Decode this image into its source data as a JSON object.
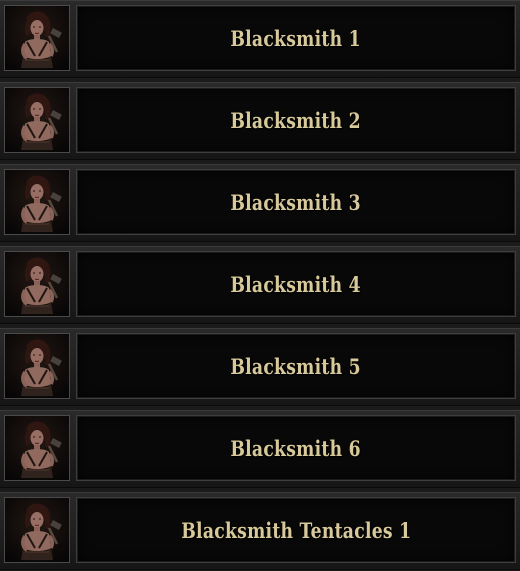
{
  "skins": [
    {
      "label": "Blacksmith 1",
      "icon": "blacksmith-portrait-icon"
    },
    {
      "label": "Blacksmith 2",
      "icon": "blacksmith-portrait-icon"
    },
    {
      "label": "Blacksmith 3",
      "icon": "blacksmith-portrait-icon"
    },
    {
      "label": "Blacksmith 4",
      "icon": "blacksmith-portrait-icon"
    },
    {
      "label": "Blacksmith 5",
      "icon": "blacksmith-portrait-icon"
    },
    {
      "label": "Blacksmith 6",
      "icon": "blacksmith-portrait-icon"
    },
    {
      "label": "Blacksmith Tentacles 1",
      "icon": "blacksmith-portrait-icon"
    }
  ],
  "colors": {
    "label_text": "#d8c99a",
    "panel_bg": "#080808",
    "row_bg": "#1b1b1b"
  }
}
